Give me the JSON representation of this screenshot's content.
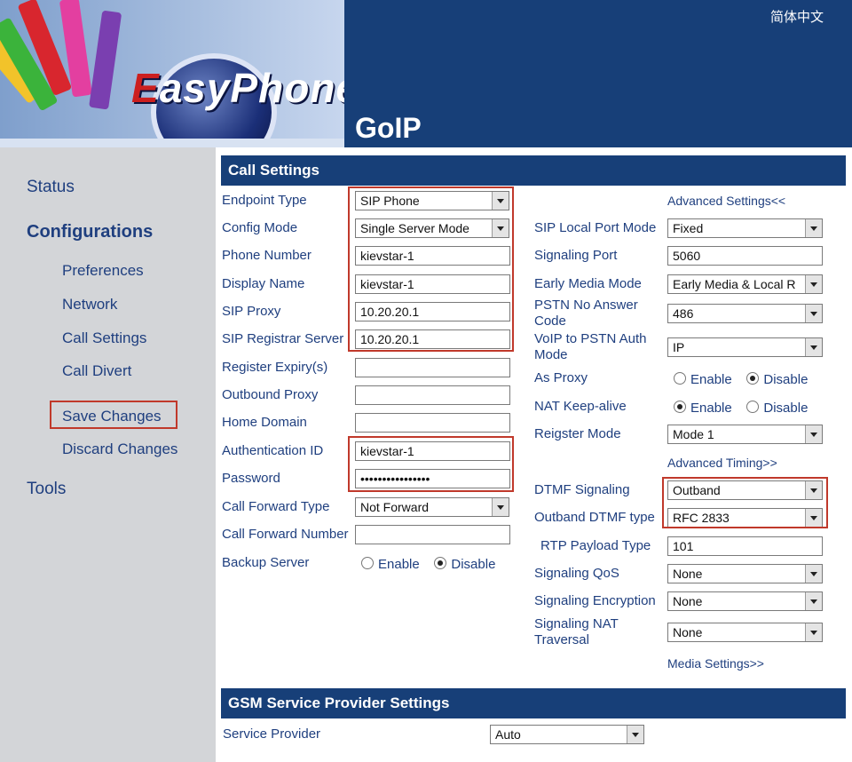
{
  "header": {
    "brand": "EasyPhone",
    "brand_initial": "E",
    "brand_rest": "asyPhone",
    "product": "GoIP",
    "language_link": "简体中文"
  },
  "sidebar": {
    "status": "Status",
    "configurations": "Configurations",
    "preferences": "Preferences",
    "network": "Network",
    "call_settings": "Call Settings",
    "call_divert": "Call Divert",
    "save_changes": "Save Changes",
    "discard_changes": "Discard Changes",
    "tools": "Tools"
  },
  "call_settings": {
    "title": "Call Settings",
    "left": {
      "endpoint_type": {
        "label": "Endpoint Type",
        "value": "SIP Phone"
      },
      "config_mode": {
        "label": "Config Mode",
        "value": "Single Server Mode"
      },
      "phone_number": {
        "label": "Phone Number",
        "value": "kievstar-1"
      },
      "display_name": {
        "label": "Display Name",
        "value": "kievstar-1"
      },
      "sip_proxy": {
        "label": "SIP Proxy",
        "value": "10.20.20.1"
      },
      "sip_registrar": {
        "label": "SIP Registrar Server",
        "value": "10.20.20.1"
      },
      "register_expiry": {
        "label": "Register Expiry(s)",
        "value": ""
      },
      "outbound_proxy": {
        "label": "Outbound Proxy",
        "value": ""
      },
      "home_domain": {
        "label": "Home Domain",
        "value": ""
      },
      "auth_id": {
        "label": "Authentication ID",
        "value": "kievstar-1"
      },
      "password": {
        "label": "Password",
        "value": "••••••••••••••••"
      },
      "call_forward_type": {
        "label": "Call Forward Type",
        "value": "Not Forward"
      },
      "call_forward_number": {
        "label": "Call Forward Number",
        "value": ""
      },
      "backup_server": {
        "label": "Backup Server",
        "enable": "Enable",
        "disable": "Disable",
        "selected": "disable"
      }
    },
    "right": {
      "advanced_settings_link": "Advanced Settings<<",
      "sip_local_port_mode": {
        "label": "SIP Local Port Mode",
        "value": "Fixed"
      },
      "signaling_port": {
        "label": "Signaling Port",
        "value": "5060"
      },
      "early_media_mode": {
        "label": "Early Media Mode",
        "value": "Early Media & Local R"
      },
      "pstn_no_answer_code": {
        "label_line1": "PSTN No Answer",
        "label_line2": "Code",
        "value": "486"
      },
      "voip_to_pstn_auth_mode": {
        "label_line1": "VoIP to PSTN Auth",
        "label_line2": "Mode",
        "value": "IP"
      },
      "as_proxy": {
        "label": "As Proxy",
        "enable": "Enable",
        "disable": "Disable",
        "selected": "disable"
      },
      "nat_keep_alive": {
        "label": "NAT Keep-alive",
        "enable": "Enable",
        "disable": "Disable",
        "selected": "enable"
      },
      "register_mode": {
        "label": "Reigster Mode",
        "value": "Mode 1"
      },
      "advanced_timing_link": "Advanced Timing>>",
      "dtmf_signaling": {
        "label": "DTMF Signaling",
        "value": "Outband"
      },
      "outband_dtmf_type": {
        "label": "Outband DTMF type",
        "value": "RFC 2833"
      },
      "rtp_payload_type": {
        "label": "RTP Payload Type",
        "value": "101"
      },
      "signaling_qos": {
        "label": "Signaling QoS",
        "value": "None"
      },
      "signaling_encryption": {
        "label": "Signaling Encryption",
        "value": "None"
      },
      "signaling_nat_traversal": {
        "label_line1": "Signaling NAT",
        "label_line2": "Traversal",
        "value": "None"
      },
      "media_settings_link": "Media Settings>>"
    }
  },
  "gsm": {
    "title": "GSM Service Provider Settings",
    "service_provider": {
      "label": "Service Provider",
      "value": "Auto"
    }
  },
  "colors": {
    "header_bg": "#173f78",
    "sidebar_bg": "#d3d5d8",
    "label_text": "#1f3f7f",
    "highlight_border": "#c0392b"
  }
}
